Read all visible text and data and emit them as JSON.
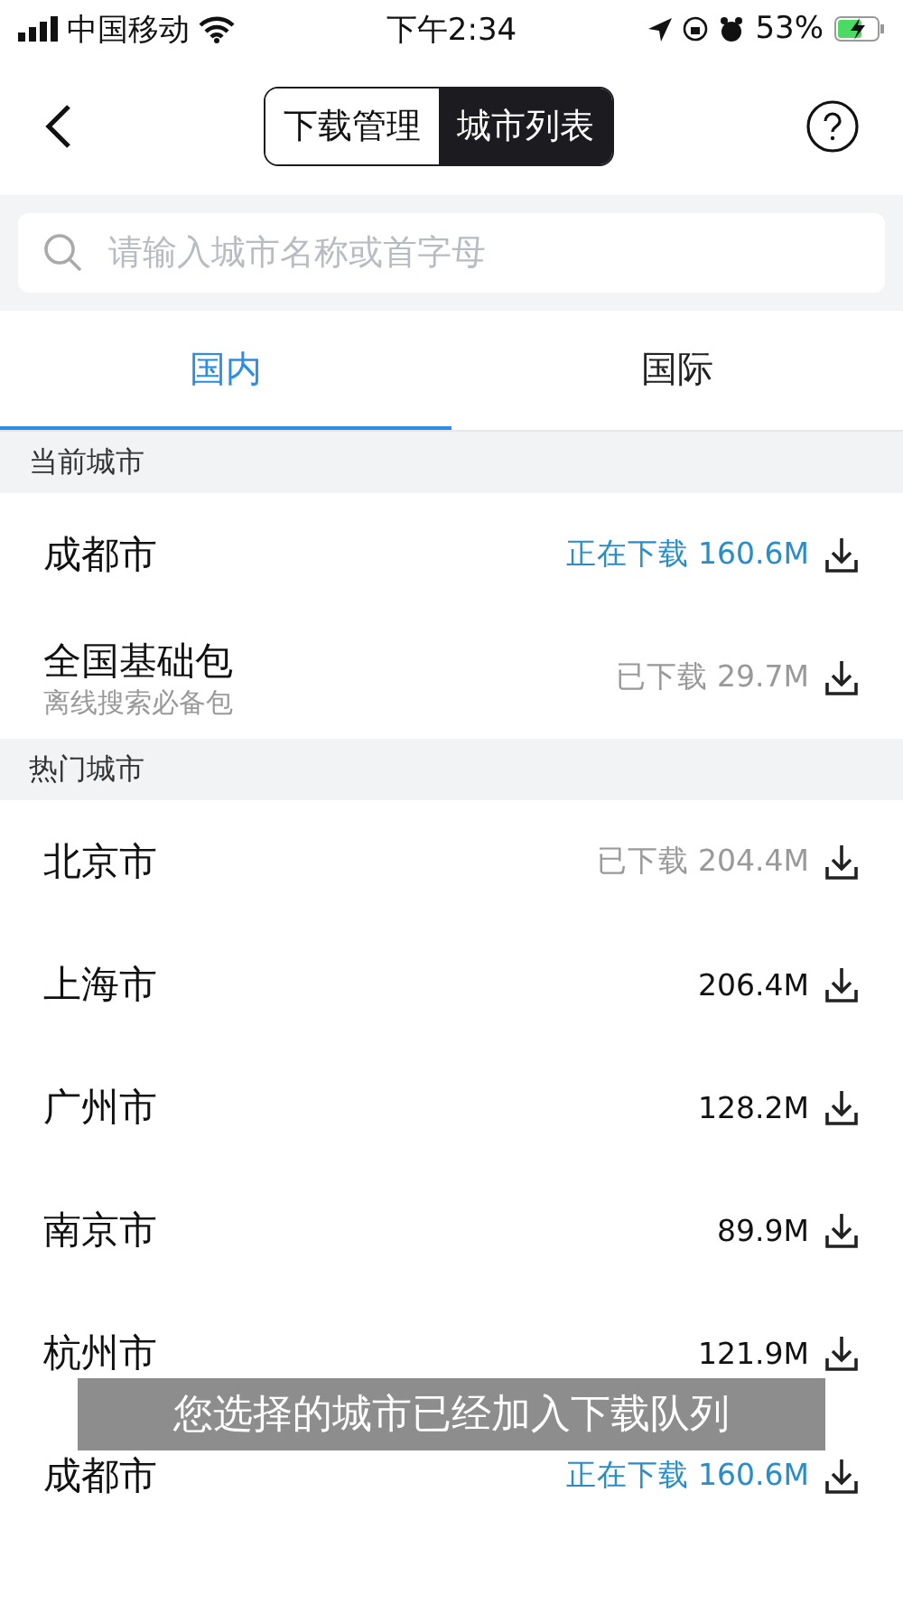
{
  "status_bar": {
    "carrier": "中国移动",
    "time": "下午2:34",
    "battery": "53%"
  },
  "nav": {
    "segments": [
      {
        "label": "下载管理",
        "selected": false
      },
      {
        "label": "城市列表",
        "selected": true
      }
    ]
  },
  "search": {
    "placeholder": "请输入城市名称或首字母"
  },
  "tabs": [
    {
      "label": "国内",
      "selected": true
    },
    {
      "label": "国际",
      "selected": false
    }
  ],
  "sections": [
    {
      "title": "当前城市",
      "rows": [
        {
          "name": "成都市",
          "kind": "downloading",
          "status_label": "正在下载",
          "size": "160.6M"
        },
        {
          "name": "全国基础包",
          "subtitle": "离线搜索必备包",
          "kind": "downloaded",
          "status_label": "已下载",
          "size": "29.7M"
        }
      ]
    },
    {
      "title": "热门城市",
      "rows": [
        {
          "name": "北京市",
          "kind": "downloaded",
          "status_label": "已下载",
          "size": "204.4M"
        },
        {
          "name": "上海市",
          "kind": "available",
          "size": "206.4M"
        },
        {
          "name": "广州市",
          "kind": "available",
          "size": "128.2M"
        },
        {
          "name": "南京市",
          "kind": "available",
          "size": "89.9M"
        },
        {
          "name": "杭州市",
          "kind": "available",
          "size": "121.9M"
        },
        {
          "name": "成都市",
          "kind": "downloading",
          "status_label": "正在下载",
          "size": "160.6M"
        }
      ]
    }
  ],
  "toast": "您选择的城市已经加入下载队列"
}
